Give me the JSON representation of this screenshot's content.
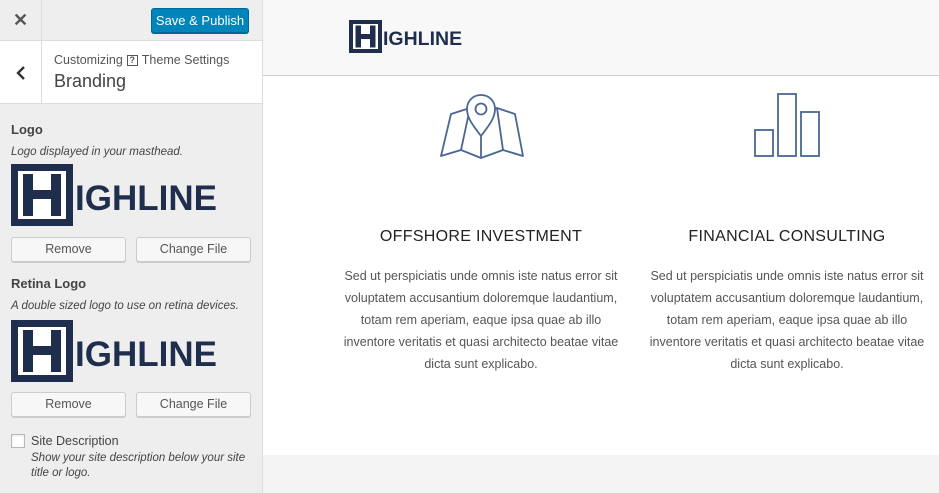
{
  "topbar": {
    "close_symbol": "✕",
    "publish_label": "Save & Publish"
  },
  "section": {
    "breadcrumb_prefix": "Customizing",
    "help_symbol": "?",
    "breadcrumb_parent": "Theme Settings",
    "title": "Branding"
  },
  "logo": {
    "title": "Logo",
    "description": "Logo displayed in your masthead.",
    "remove_label": "Remove",
    "change_label": "Change File"
  },
  "retina_logo": {
    "title": "Retina Logo",
    "description": "A double sized logo to use on retina devices.",
    "remove_label": "Remove",
    "change_label": "Change File"
  },
  "site_description": {
    "label": "Site Description",
    "description": "Show your site description below your site title or logo.",
    "checked": false
  },
  "brand": {
    "logo_letter": "H",
    "logo_rest": "IGHLINE",
    "logo_color": "#1f2e4d"
  },
  "services": [
    {
      "icon": "map-pin-icon",
      "title": "OFFSHORE INVESTMENT",
      "text": "Sed ut perspiciatis unde omnis iste natus error sit voluptatem accusantium doloremque laudantium, totam rem aperiam, eaque ipsa quae ab illo inventore veritatis et quasi architecto beatae vitae dicta sunt explicabo."
    },
    {
      "icon": "bar-chart-icon",
      "title": "FINANCIAL CONSULTING",
      "text": "Sed ut perspiciatis unde omnis iste natus error sit voluptatem accusantium doloremque laudantium, totam rem aperiam, eaque ipsa quae ab illo inventore veritatis et quasi architecto beatae vitae dicta sunt explicabo."
    }
  ],
  "colors": {
    "accent": "#0085ba",
    "icon_stroke": "#4a6793"
  }
}
